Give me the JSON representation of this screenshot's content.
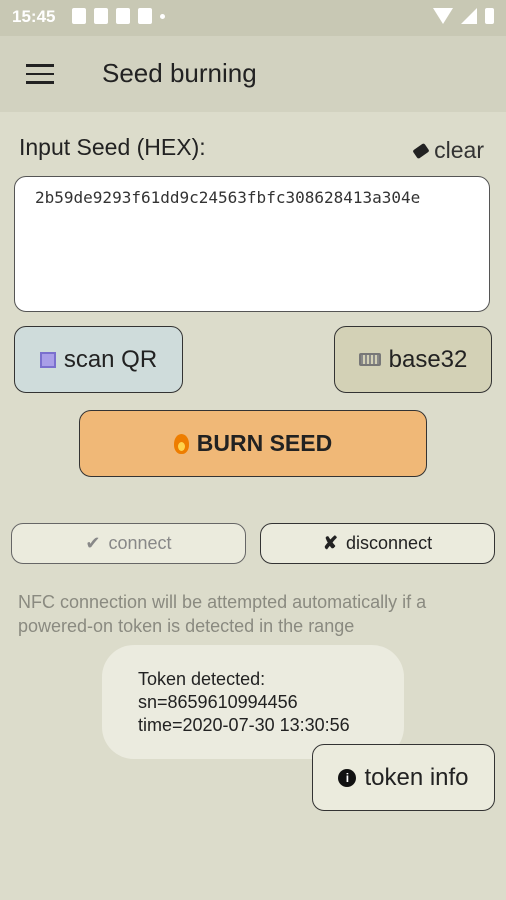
{
  "status": {
    "time": "15:45"
  },
  "appbar": {
    "title": "Seed burning"
  },
  "input": {
    "label": "Input Seed (HEX):",
    "clear_label": "clear",
    "seed_value": "2b59de9293f61dd9c24563fbfc308628413a304e"
  },
  "buttons": {
    "scan_qr": "scan QR",
    "base32": "base32",
    "burn_seed": "BURN SEED",
    "connect": "connect",
    "disconnect": "disconnect",
    "token_info": "token info"
  },
  "nfc_info": "NFC connection will be attempted automatically if a powered-on token is detected in the range",
  "toast": {
    "line1": "Token detected:",
    "line2": "sn=8659610994456",
    "line3": "time=2020-07-30 13:30:56"
  },
  "colors": {
    "background": "#dcdccb",
    "burn_button": "#f0b877",
    "scan_button": "#cfdcdb",
    "base32_button": "#d3d1b6"
  }
}
